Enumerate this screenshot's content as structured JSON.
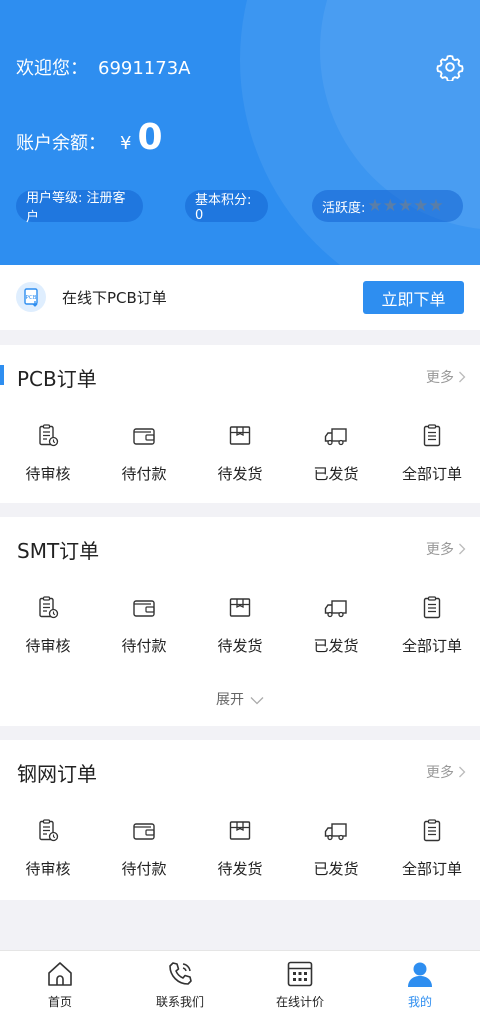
{
  "header": {
    "welcome_label": "欢迎您：",
    "user_id": "6991173A",
    "balance_label": "账户余额：",
    "currency": "¥",
    "balance": "0",
    "level_label": "用户等级: 注册客户",
    "points_label": "基本积分: 0",
    "activity_label": "活跃度:",
    "activity_stars": 0
  },
  "quick_order": {
    "text": "在线下PCB订单",
    "button": "立即下单"
  },
  "sections": {
    "pcb": {
      "title": "PCB订单",
      "more": "更多",
      "items": [
        "待审核",
        "待付款",
        "待发货",
        "已发货",
        "全部订单"
      ]
    },
    "smt": {
      "title": "SMT订单",
      "more": "更多",
      "items": [
        "待审核",
        "待付款",
        "待发货",
        "已发货",
        "全部订单"
      ],
      "expand": "展开"
    },
    "stencil": {
      "title": "钢网订单",
      "more": "更多",
      "items": [
        "待审核",
        "待付款",
        "待发货",
        "已发货",
        "全部订单"
      ]
    }
  },
  "bottom_nav": {
    "items": [
      {
        "label": "首页",
        "icon": "home-icon"
      },
      {
        "label": "联系我们",
        "icon": "phone-icon"
      },
      {
        "label": "在线计价",
        "icon": "calculator-icon"
      },
      {
        "label": "我的",
        "icon": "user-icon"
      }
    ],
    "active_index": 3
  },
  "colors": {
    "accent": "#2e8ef0",
    "header_bg": "#2e8ef0",
    "page_bg": "#f2f2f6"
  }
}
